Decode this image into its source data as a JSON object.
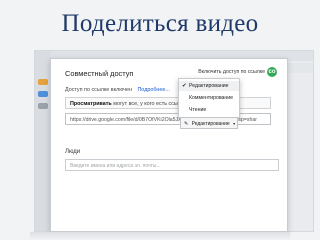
{
  "slide": {
    "title": "Поделиться видео"
  },
  "dialog": {
    "title": "Совместный доступ",
    "link_sharing_label": "Включить доступ по ссылке",
    "status_text": "Доступ по ссылке включен",
    "more_link": "Подробнее...",
    "access_bold": "Просматривать",
    "access_rest": "могут все, у кого есть ссылка",
    "url": "https://drive.google.com/file/d/0B7OfVKi2Ola5JXRZmd4cnhvMG8/view?usp=shar",
    "people_label": "Люди",
    "people_placeholder": "Введите имена или адреса эл. почты..."
  },
  "menu": {
    "items": [
      {
        "label": "Редактирование",
        "selected": true
      },
      {
        "label": "Комментирование",
        "selected": false
      },
      {
        "label": "Чтение",
        "selected": false
      }
    ],
    "check_glyph": "✔"
  },
  "permission_button": {
    "label": "Редактирование",
    "caret": "▾"
  },
  "icons": {
    "toggle": "link-toggle-icon",
    "pencil": "pencil-icon",
    "caret": "chevron-down-icon"
  },
  "colors": {
    "title": "#1f3a68",
    "toggle": "#35a85a",
    "link": "#1a5bd6"
  }
}
